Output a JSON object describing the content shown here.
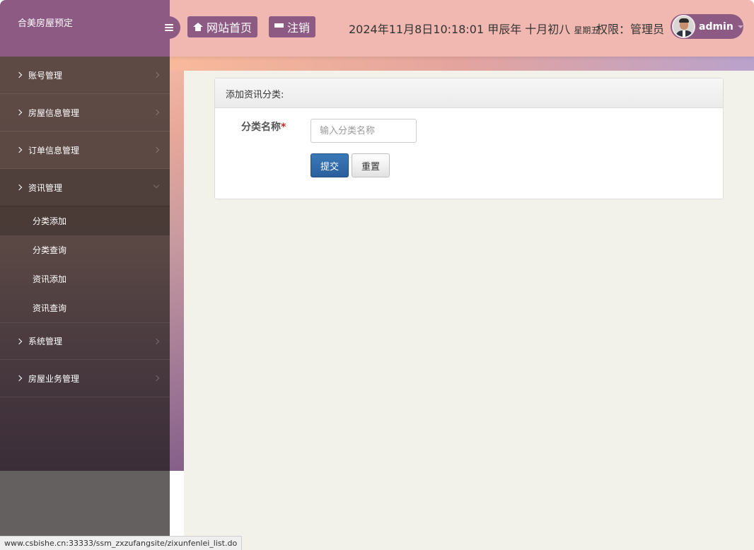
{
  "brand": {
    "title": "合美房屋预定"
  },
  "header": {
    "home_label": "网站首页",
    "logout_label": "注销",
    "datetime": "2024年11月8日10:18:01 甲辰年 十月初八",
    "weekday": "星期五",
    "permission": "权限：管理员",
    "username": "admin"
  },
  "sidebar": {
    "items": [
      {
        "label": "账号管理"
      },
      {
        "label": "房屋信息管理"
      },
      {
        "label": "订单信息管理"
      },
      {
        "label": "资讯管理",
        "open": true,
        "children": [
          {
            "label": "分类添加",
            "active": true
          },
          {
            "label": "分类查询"
          },
          {
            "label": "资讯添加"
          },
          {
            "label": "资讯查询"
          }
        ]
      },
      {
        "label": "系统管理"
      },
      {
        "label": "房屋业务管理"
      }
    ]
  },
  "form": {
    "panel_title": "添加资讯分类:",
    "field_label": "分类名称",
    "required_mark": "*",
    "input_value": "",
    "input_placeholder": "输入分类名称",
    "submit_label": "提交",
    "reset_label": "重置"
  },
  "status_bar": {
    "url": "www.csbishe.cn:33333/ssm_zxzufangsite/zixunfenlei_list.do"
  },
  "colors": {
    "accent": "#8c5a82",
    "header_bg": "#f0b8b0",
    "primary_button": "#2a5f9c",
    "required": "#c0292b"
  }
}
